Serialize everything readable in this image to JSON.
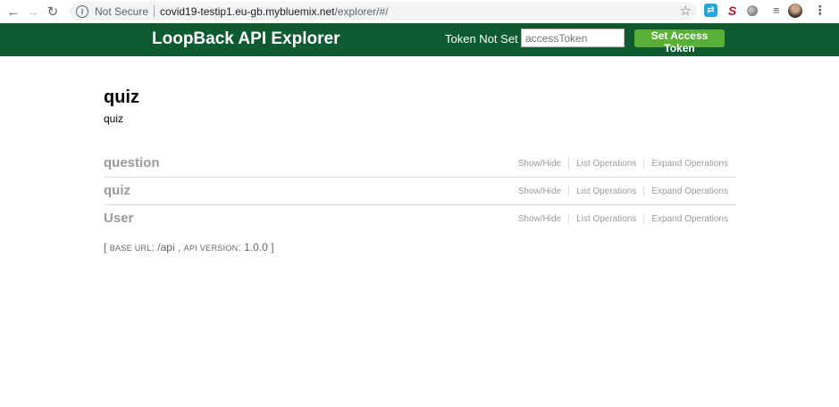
{
  "browser": {
    "security_label": "Not Secure",
    "url_host": "covid19-testip1.eu-gb.mybluemix.net",
    "url_path": "/explorer/#/"
  },
  "header": {
    "title": "LoopBack API Explorer",
    "token_status": "Token Not Set",
    "token_placeholder": "accessToken",
    "set_token_label": "Set Access Token",
    "background_color": "#0e5a31",
    "button_color": "#5ab036"
  },
  "api": {
    "title": "quiz",
    "description": "quiz"
  },
  "resources": [
    {
      "name": "question",
      "show_hide": "Show/Hide",
      "list_ops": "List Operations",
      "expand_ops": "Expand Operations"
    },
    {
      "name": "quiz",
      "show_hide": "Show/Hide",
      "list_ops": "List Operations",
      "expand_ops": "Expand Operations"
    },
    {
      "name": "User",
      "show_hide": "Show/Hide",
      "list_ops": "List Operations",
      "expand_ops": "Expand Operations"
    }
  ],
  "footer_info": {
    "open_bracket": "[",
    "base_url_label": "BASE URL",
    "base_url_value": "/api",
    "api_version_label": "API VERSION",
    "api_version_value": "1.0.0",
    "close_bracket": "]"
  }
}
